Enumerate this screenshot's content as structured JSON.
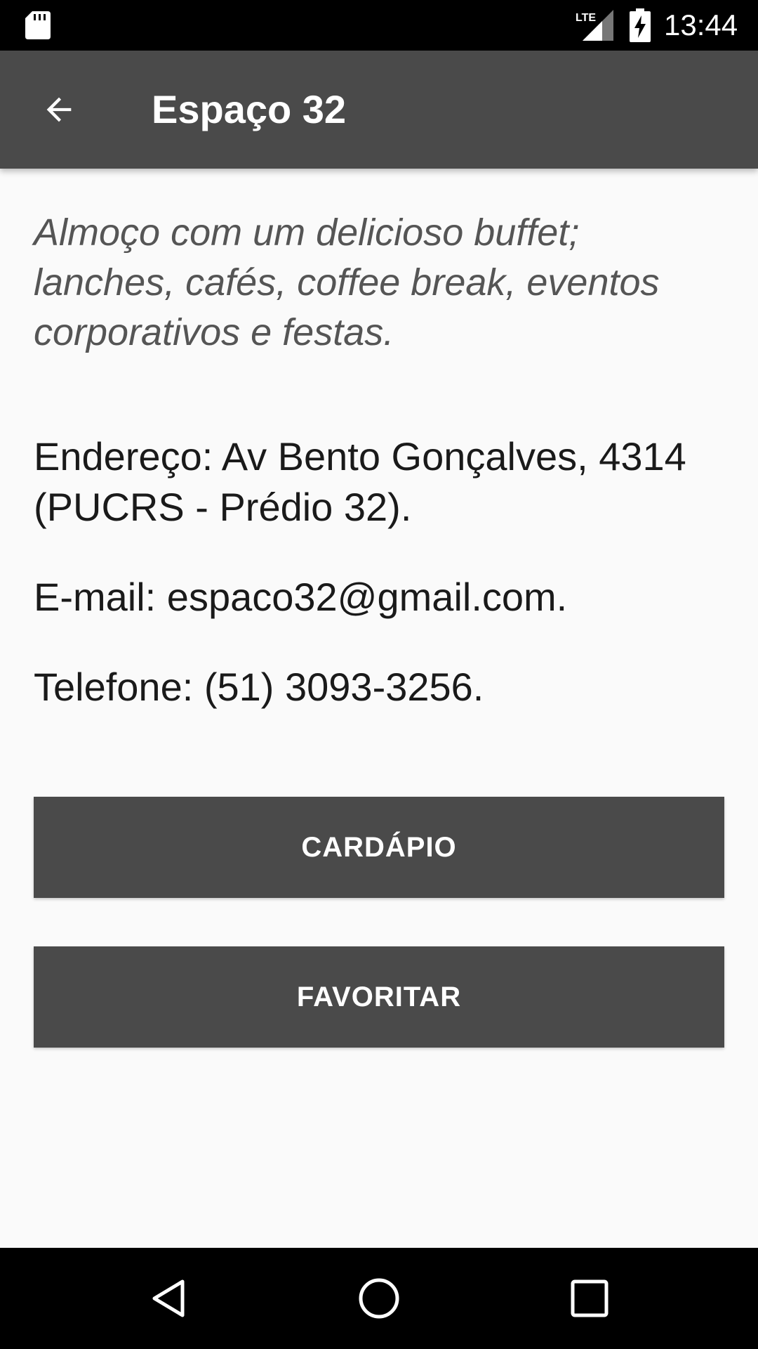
{
  "status_bar": {
    "time": "13:44",
    "network_label": "LTE",
    "icons": [
      "sd-card-icon",
      "lte-signal-icon",
      "battery-charging-icon"
    ]
  },
  "app_bar": {
    "title": "Espaço 32",
    "back_icon": "arrow-back-icon"
  },
  "content": {
    "description": "Almoço com um delicioso buffet; lanches, cafés, coffee break, eventos corporativos e festas.",
    "address": "Endereço: Av Bento Gonçalves, 4314 (PUCRS - Prédio 32).",
    "email": "E-mail: espaco32@gmail.com.",
    "phone": "Telefone: (51) 3093-3256."
  },
  "buttons": {
    "menu_label": "CARDÁPIO",
    "favorite_label": "FAVORITAR"
  },
  "nav_bar": {
    "icons": [
      "nav-back-icon",
      "nav-home-icon",
      "nav-recents-icon"
    ]
  },
  "colors": {
    "primary": "#4a4a4a",
    "background": "#fafafa",
    "status_bar": "#000000"
  }
}
